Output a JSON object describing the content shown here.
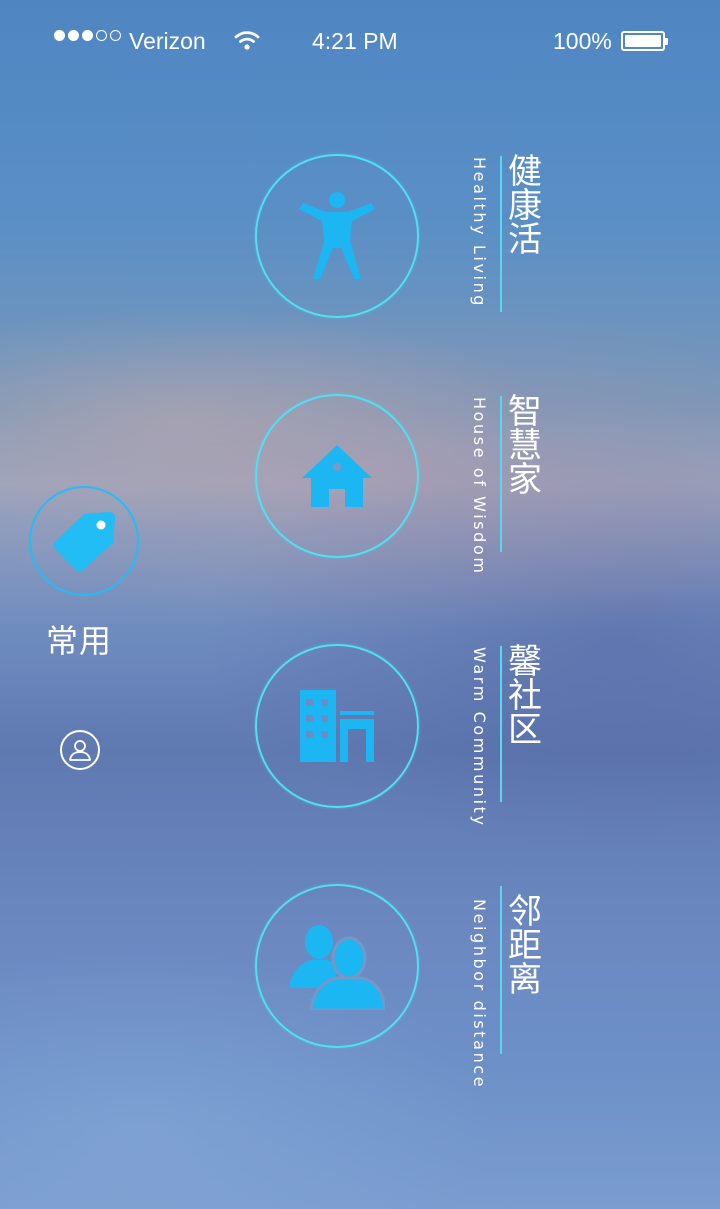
{
  "status_bar": {
    "signal_dots": "●●●○○",
    "carrier": "Verizon",
    "time": "4:21 PM",
    "battery_percent": "100%",
    "battery_level": 1.0
  },
  "menu": [
    {
      "title_cn": "健康活",
      "subtitle_en": "Healthy Living",
      "icon": "person-arms-up-icon"
    },
    {
      "title_cn": "智慧家",
      "subtitle_en": "House of Wisdom",
      "icon": "home-icon"
    },
    {
      "title_cn": "馨社区",
      "subtitle_en": "Warm Community",
      "icon": "buildings-icon"
    },
    {
      "title_cn": "邻距离",
      "subtitle_en": "Neighbor distance",
      "icon": "users-icon"
    }
  ],
  "side": {
    "favorites_label": "常用",
    "favorites_icon": "tag-icon",
    "profile_icon": "user-icon"
  },
  "colors": {
    "accent": "#1cb6f2",
    "ring": "#4fe0f2"
  }
}
